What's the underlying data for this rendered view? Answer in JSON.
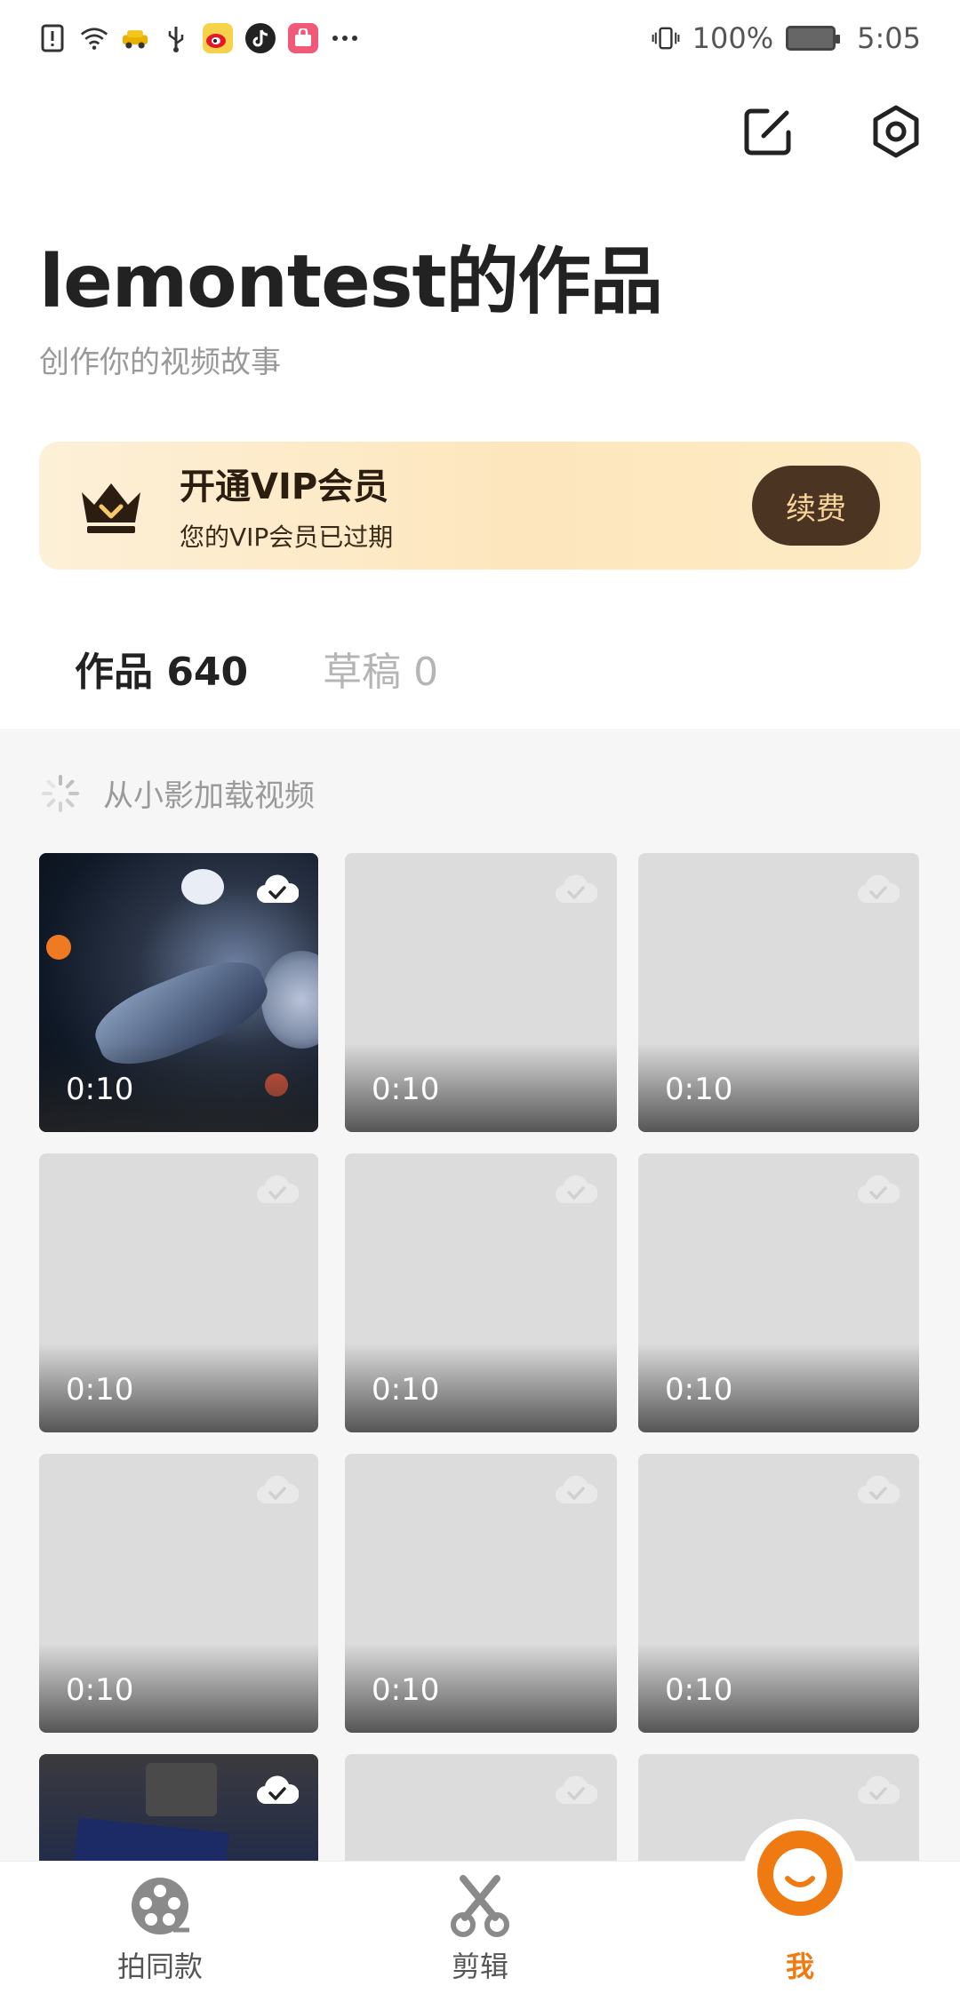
{
  "status_bar": {
    "battery_text": "100%",
    "time": "5:05",
    "icons": [
      "alert-icon",
      "wifi-icon",
      "taxi-app-icon",
      "usb-icon",
      "weibo-app-icon",
      "tiktok-app-icon",
      "shop-app-icon",
      "more-icon",
      "vibrate-icon",
      "battery-icon"
    ]
  },
  "header": {
    "title": "lemontest的作品",
    "subtitle": "创作你的视频故事",
    "actions": [
      "edit-icon",
      "settings-icon"
    ]
  },
  "vip": {
    "title": "开通VIP会员",
    "subtitle": "您的VIP会员已过期",
    "button": "续费",
    "colors": {
      "banner": "#fde6bd",
      "button": "#4b3522",
      "button_text": "#f7d59b"
    }
  },
  "tabs": [
    {
      "label": "作品 640",
      "active": true
    },
    {
      "label": "草稿 0",
      "active": false
    }
  ],
  "loading_text": "从小影加载视频",
  "videos": [
    {
      "duration": "0:10",
      "thumb": "space",
      "synced": true
    },
    {
      "duration": "0:10",
      "thumb": "placeholder",
      "synced": false
    },
    {
      "duration": "0:10",
      "thumb": "placeholder",
      "synced": false
    },
    {
      "duration": "0:10",
      "thumb": "placeholder",
      "synced": false
    },
    {
      "duration": "0:10",
      "thumb": "placeholder",
      "synced": false
    },
    {
      "duration": "0:10",
      "thumb": "placeholder",
      "synced": false
    },
    {
      "duration": "0:10",
      "thumb": "placeholder",
      "synced": false
    },
    {
      "duration": "0:10",
      "thumb": "placeholder",
      "synced": false
    },
    {
      "duration": "0:10",
      "thumb": "placeholder",
      "synced": false
    },
    {
      "duration": "",
      "thumb": "desk",
      "synced": true
    },
    {
      "duration": "",
      "thumb": "placeholder",
      "synced": false
    },
    {
      "duration": "",
      "thumb": "placeholder",
      "synced": false
    }
  ],
  "bottom_nav": [
    {
      "label": "拍同款",
      "icon": "film-reel-icon",
      "active": false
    },
    {
      "label": "剪辑",
      "icon": "scissors-icon",
      "active": false
    },
    {
      "label": "我",
      "icon": "profile-face-icon",
      "active": true
    }
  ],
  "accent_color": "#f07a12"
}
